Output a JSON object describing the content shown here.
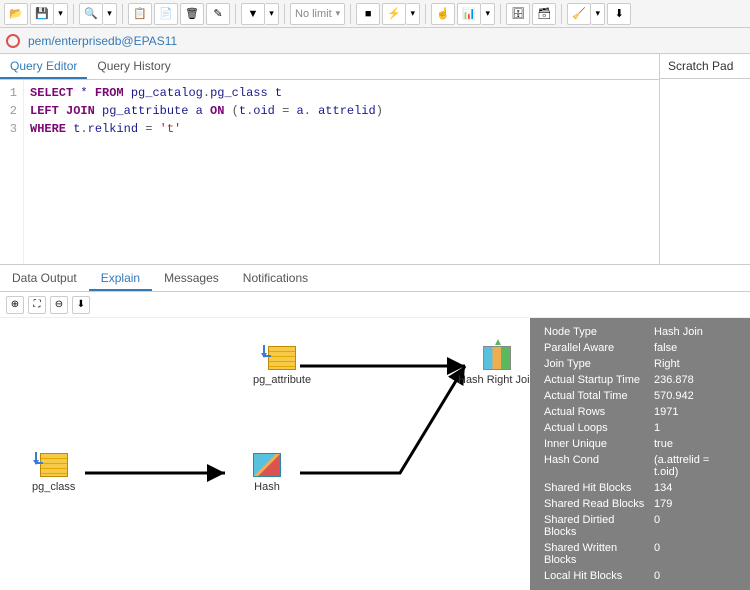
{
  "toolbar": {
    "limit_label": "No limit"
  },
  "connection": {
    "label": "pem/enterprisedb@EPAS11"
  },
  "editor_tabs": {
    "query_editor": "Query Editor",
    "query_history": "Query History"
  },
  "scratch_label": "Scratch Pad",
  "sql": {
    "line1": {
      "select": "SELECT",
      "star": " * ",
      "from": "FROM",
      "pg_catalog": " pg_catalog",
      "dot1": ".",
      "pg_class": "pg_class",
      "sp": " t"
    },
    "line2": {
      "left": "LEFT",
      "join": " JOIN",
      "tbl": " pg_attribute a ",
      "on": "ON",
      "open": " (",
      "t": "t",
      "dot": ".",
      "oid": "oid",
      "eq": " = ",
      "a": "a",
      "dot2": ".",
      "sp": " ",
      "attr": "attrelid",
      "close": ")"
    },
    "line3": {
      "where": "WHERE",
      "t": " t",
      "dot": ".",
      "col": "relkind",
      "eq": " = ",
      "val": "'t'"
    }
  },
  "bottom_tabs": {
    "data_output": "Data Output",
    "explain": "Explain",
    "messages": "Messages",
    "notifications": "Notifications"
  },
  "nodes": {
    "pg_class": "pg_class",
    "pg_attribute": "pg_attribute",
    "hash": "Hash",
    "hash_right_join": "Hash Right Join"
  },
  "tooltip": [
    {
      "k": "Node Type",
      "v": "Hash Join"
    },
    {
      "k": "Parallel Aware",
      "v": "false"
    },
    {
      "k": "Join Type",
      "v": "Right"
    },
    {
      "k": "Actual Startup Time",
      "v": "236.878"
    },
    {
      "k": "Actual Total Time",
      "v": "570.942"
    },
    {
      "k": "Actual Rows",
      "v": "1971"
    },
    {
      "k": "Actual Loops",
      "v": "1"
    },
    {
      "k": "Inner Unique",
      "v": "true"
    },
    {
      "k": "Hash Cond",
      "v": "(a.attrelid = t.oid)"
    },
    {
      "k": "Shared Hit Blocks",
      "v": "134"
    },
    {
      "k": "Shared Read Blocks",
      "v": "179"
    },
    {
      "k": "Shared Dirtied Blocks",
      "v": "0"
    },
    {
      "k": "Shared Written Blocks",
      "v": "0"
    },
    {
      "k": "Local Hit Blocks",
      "v": "0"
    }
  ],
  "line_numbers": [
    "1",
    "2",
    "3"
  ]
}
